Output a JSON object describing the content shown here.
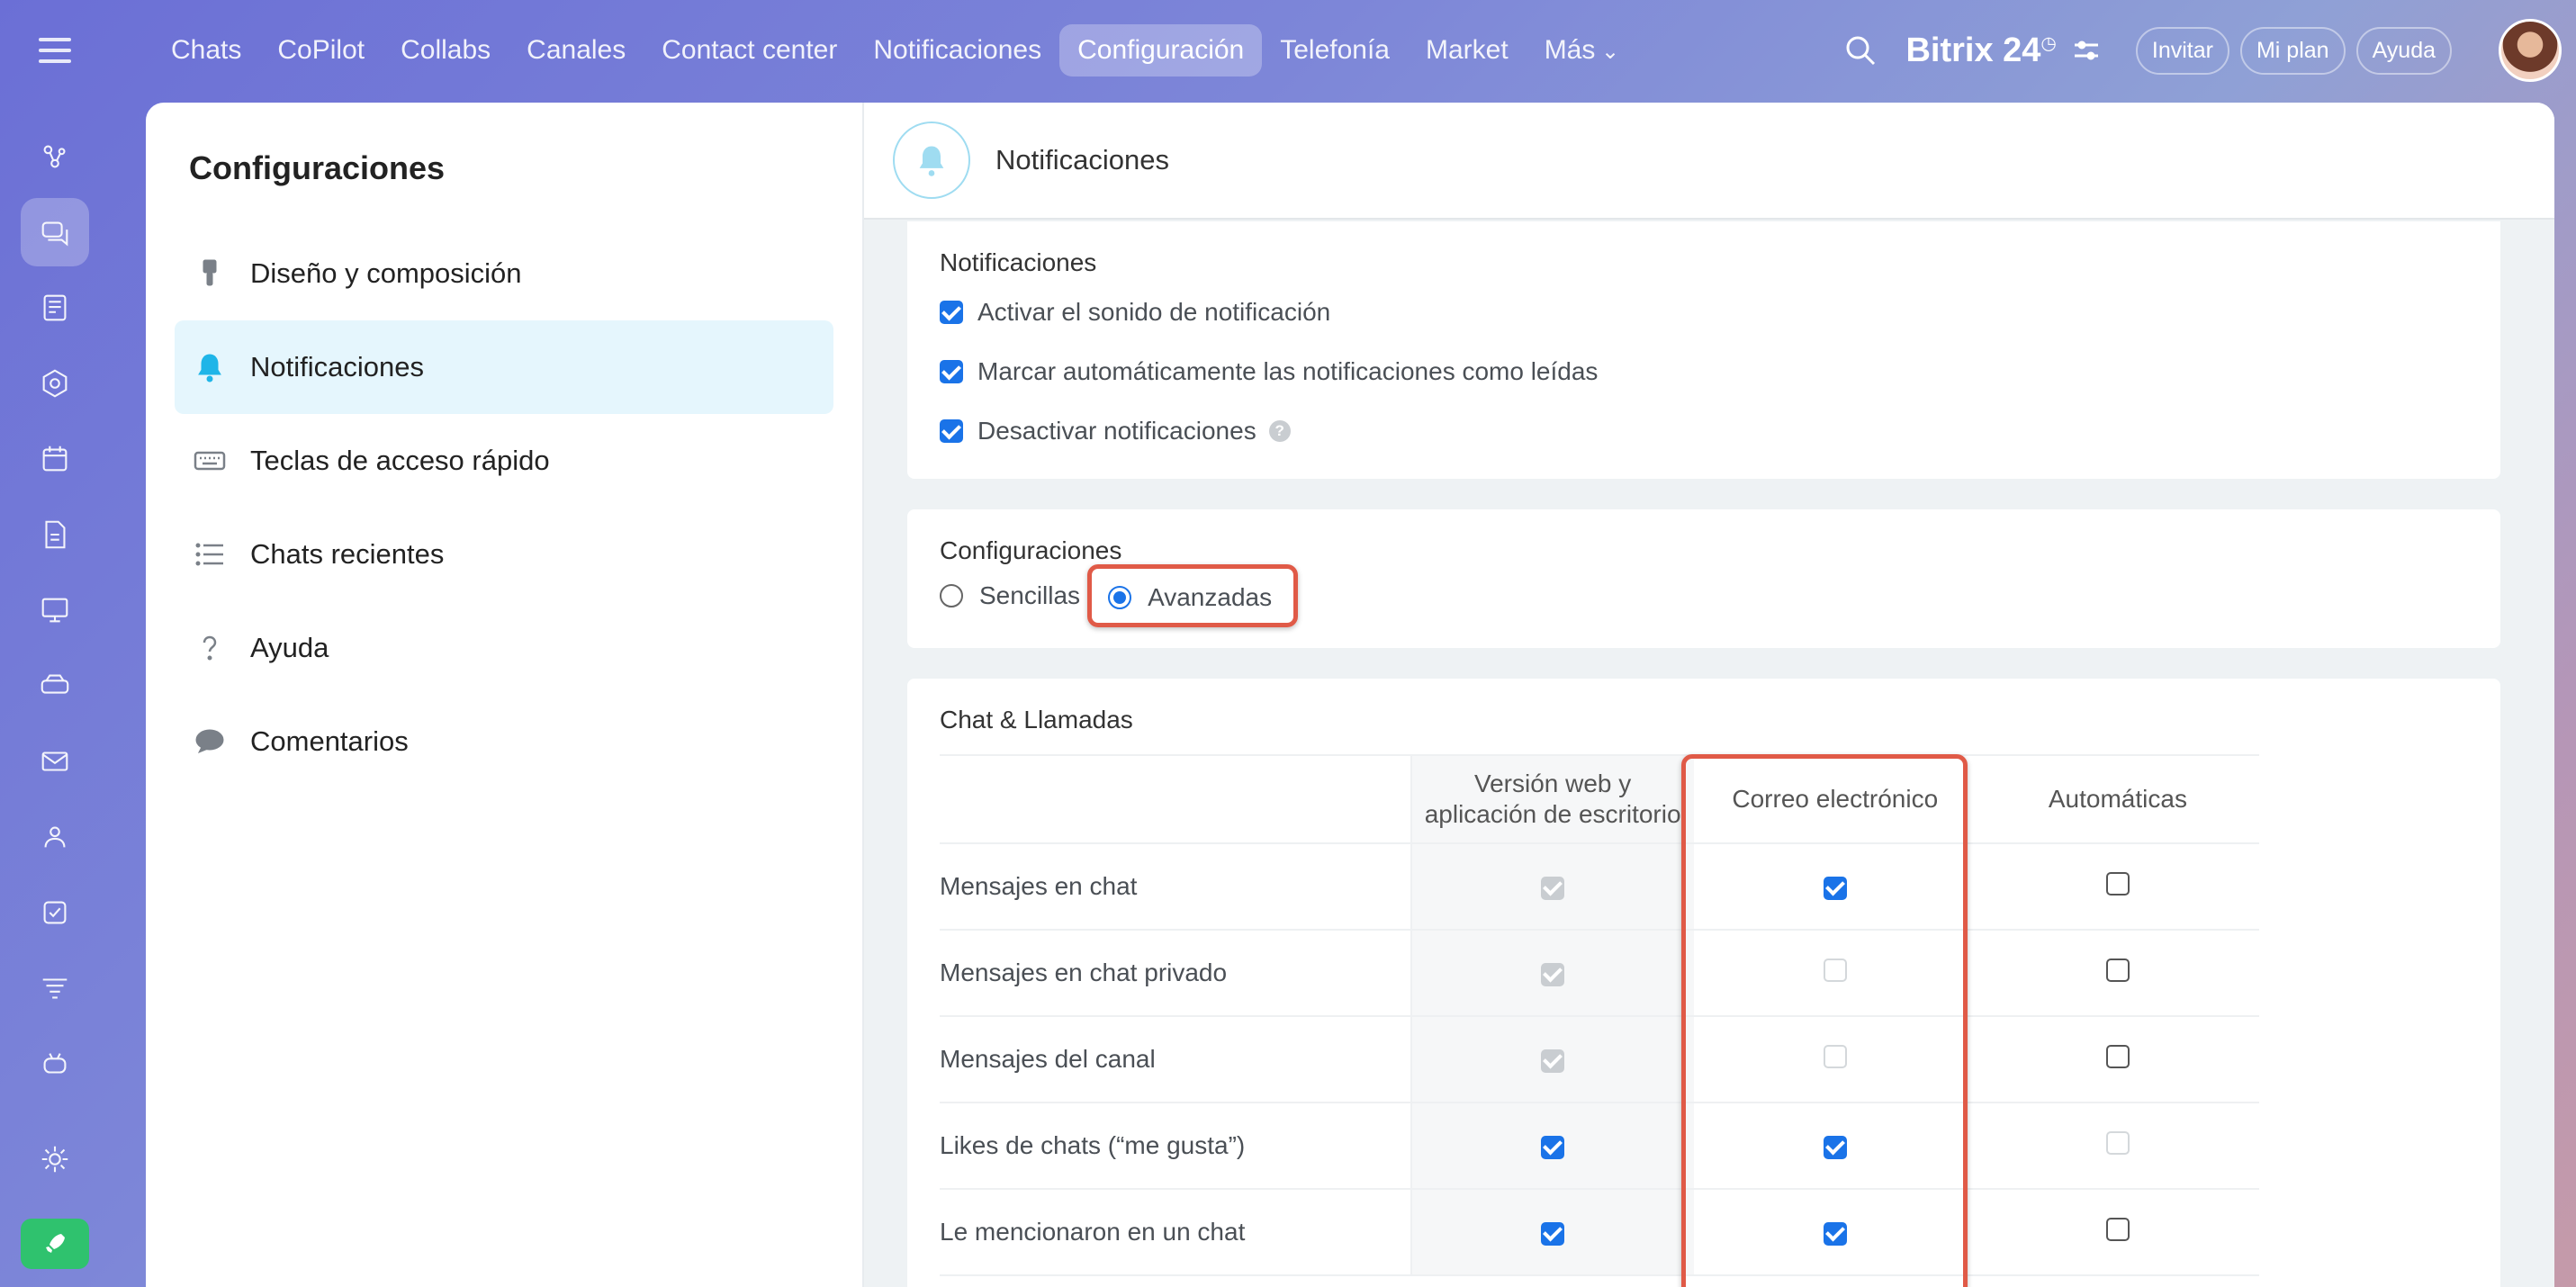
{
  "topnav": {
    "items": [
      "Chats",
      "CoPilot",
      "Collabs",
      "Canales",
      "Contact center",
      "Notificaciones",
      "Configuración",
      "Telefonía",
      "Market",
      "Más"
    ],
    "active_index": 6
  },
  "brand": {
    "name": "Bitrix 24"
  },
  "top_buttons": {
    "invite": "Invitar",
    "plan": "Mi plan",
    "help": "Ayuda"
  },
  "sidebar": {
    "title": "Configuraciones",
    "items": [
      {
        "label": "Diseño y composición",
        "icon": "brush-icon"
      },
      {
        "label": "Notificaciones",
        "icon": "bell-icon",
        "active": true
      },
      {
        "label": "Teclas de acceso rápido",
        "icon": "keyboard-icon"
      },
      {
        "label": "Chats recientes",
        "icon": "list-icon"
      },
      {
        "label": "Ayuda",
        "icon": "question-icon"
      },
      {
        "label": "Comentarios",
        "icon": "comment-icon"
      }
    ]
  },
  "content": {
    "title": "Notificaciones",
    "notifications": {
      "heading": "Notificaciones",
      "options": [
        {
          "label": "Activar el sonido de notificación",
          "checked": true
        },
        {
          "label": "Marcar automáticamente las notificaciones como leídas",
          "checked": true
        },
        {
          "label": "Desactivar notificaciones",
          "checked": true
        }
      ]
    },
    "settings": {
      "heading": "Configuraciones",
      "options": [
        "Sencillas",
        "Avanzadas"
      ],
      "selected": "Avanzadas"
    },
    "chat_calls": {
      "heading": "Chat & Llamadas",
      "columns": [
        "Versión web y aplicación de escritorio",
        "Correo electrónico",
        "Automáticas"
      ],
      "rows": [
        {
          "label": "Mensajes en chat",
          "web": "grey-on",
          "email": "on",
          "auto": "off"
        },
        {
          "label": "Mensajes en chat privado",
          "web": "grey-on",
          "email": "disabled",
          "auto": "off"
        },
        {
          "label": "Mensajes del canal",
          "web": "grey-on",
          "email": "disabled",
          "auto": "off"
        },
        {
          "label": "Likes de chats (“me gusta”)",
          "web": "on",
          "email": "on",
          "auto": "disabled"
        },
        {
          "label": "Le mencionaron en un chat",
          "web": "on",
          "email": "on",
          "auto": "off"
        }
      ]
    }
  }
}
